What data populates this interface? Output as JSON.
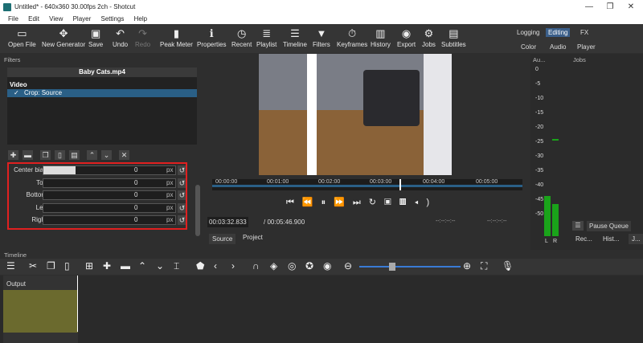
{
  "window": {
    "title": "Untitled* - 640x360 30.00fps 2ch - Shotcut",
    "buttons": [
      "—",
      "❐",
      "✕"
    ]
  },
  "menu": [
    "File",
    "Edit",
    "View",
    "Player",
    "Settings",
    "Help"
  ],
  "toolbar": [
    {
      "label": "Open File",
      "icon": "open-icon"
    },
    {
      "label": "New Generator",
      "icon": "generator-icon"
    },
    {
      "label": "Save",
      "icon": "save-icon"
    },
    {
      "label": "Undo",
      "icon": "undo-icon"
    },
    {
      "label": "Redo",
      "icon": "redo-icon"
    },
    {
      "label": "Peak Meter",
      "icon": "meter-icon"
    },
    {
      "label": "Properties",
      "icon": "info-icon"
    },
    {
      "label": "Recent",
      "icon": "clock-icon"
    },
    {
      "label": "Playlist",
      "icon": "playlist-icon"
    },
    {
      "label": "Timeline",
      "icon": "timeline-icon"
    },
    {
      "label": "Filters",
      "icon": "filter-icon"
    },
    {
      "label": "Keyframes",
      "icon": "stopwatch-icon"
    },
    {
      "label": "History",
      "icon": "history-icon"
    },
    {
      "label": "Export",
      "icon": "export-icon"
    },
    {
      "label": "Jobs",
      "icon": "gear-icon"
    },
    {
      "label": "Subtitles",
      "icon": "subtitles-icon"
    }
  ],
  "layouts": {
    "row1": [
      "Logging",
      "Editing",
      "FX"
    ],
    "row2": [
      "Color",
      "Audio",
      "Player"
    ],
    "selected": "Editing"
  },
  "filters": {
    "header": "Filters",
    "clip_name": "Baby Cats.mp4",
    "section": "Video",
    "checkbox": "✓",
    "filter": "Crop: Source",
    "params": [
      {
        "label": "Center bias",
        "value": "0",
        "unit": "px"
      },
      {
        "label": "Top",
        "value": "0",
        "unit": "px"
      },
      {
        "label": "Bottom",
        "value": "0",
        "unit": "px"
      },
      {
        "label": "Left",
        "value": "0",
        "unit": "px"
      },
      {
        "label": "Right",
        "value": "0",
        "unit": "px"
      }
    ]
  },
  "player": {
    "ticks": [
      "00:00:00",
      "00:01:00",
      "00:02:00",
      "00:03:00",
      "00:04:00",
      "00:05:00"
    ],
    "position": "00:03:32.833",
    "duration": "/ 00:05:46.900",
    "in_point": "--:--:--:--",
    "out_point": "--:--:--:--",
    "tabs": [
      "Source",
      "Project"
    ]
  },
  "audio": {
    "header": "Au...",
    "scale": [
      "0",
      "-5",
      "-10",
      "-15",
      "-20",
      "-25",
      "-30",
      "-35",
      "-40",
      "-45",
      "-50"
    ],
    "channels": [
      "L",
      "R"
    ]
  },
  "jobs": {
    "header": "Jobs",
    "pause": "Pause Queue",
    "tabs": [
      "Rec...",
      "Hist...",
      "J..."
    ]
  },
  "timeline": {
    "header": "Timeline",
    "track": "Output"
  }
}
